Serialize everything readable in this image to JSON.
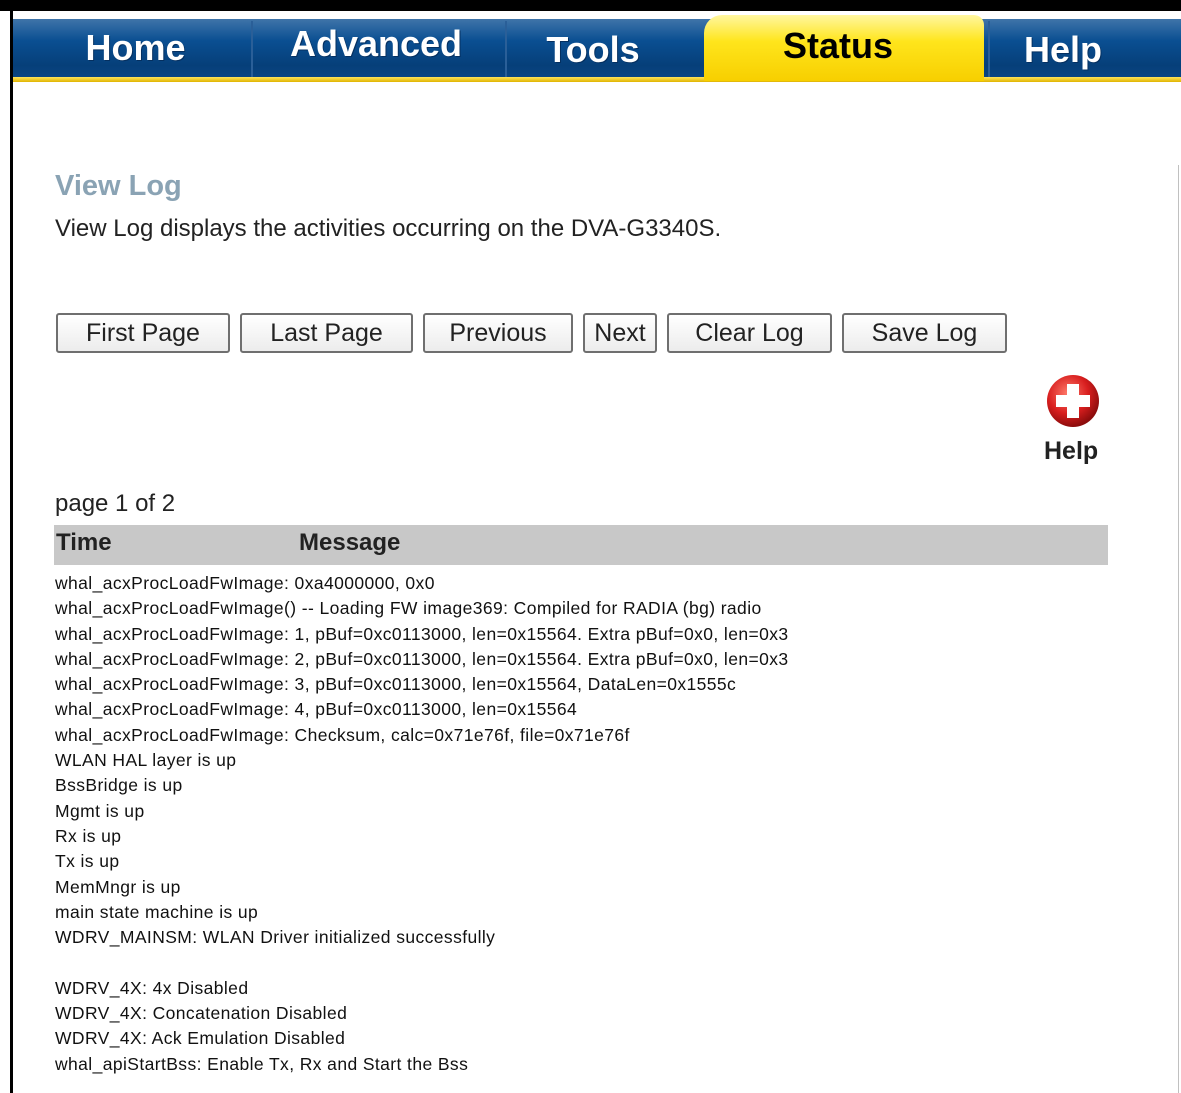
{
  "nav": {
    "tabs": [
      {
        "label": "Home",
        "active": false
      },
      {
        "label": "Advanced",
        "active": false
      },
      {
        "label": "Tools",
        "active": false
      },
      {
        "label": "Status",
        "active": true
      },
      {
        "label": "Help",
        "active": false
      }
    ]
  },
  "colors": {
    "nav_blue": "#0a4f92",
    "active_tab": "#ffe51c",
    "title": "#8aa3b4",
    "header_bg": "#c8c8c8",
    "help_icon": "#d81e1e"
  },
  "page": {
    "title": "View Log",
    "description": "View Log displays the activities occurring on the DVA-G3340S."
  },
  "buttons": {
    "first_page": "First Page",
    "last_page": "Last Page",
    "previous": "Previous",
    "next": "Next",
    "clear_log": "Clear Log",
    "save_log": "Save Log"
  },
  "help": {
    "label": "Help",
    "icon": "plus-circle-icon"
  },
  "log": {
    "page_indicator": "page 1 of 2",
    "columns": {
      "time": "Time",
      "message": "Message"
    },
    "entries": [
      "whal_acxProcLoadFwImage: 0xa4000000, 0x0",
      "whal_acxProcLoadFwImage() -- Loading FW image369: Compiled for RADIA (bg) radio",
      "whal_acxProcLoadFwImage: 1, pBuf=0xc0113000, len=0x15564. Extra pBuf=0x0, len=0x3",
      "whal_acxProcLoadFwImage: 2, pBuf=0xc0113000, len=0x15564. Extra pBuf=0x0, len=0x3",
      "whal_acxProcLoadFwImage: 3, pBuf=0xc0113000, len=0x15564, DataLen=0x1555c",
      "whal_acxProcLoadFwImage: 4, pBuf=0xc0113000, len=0x15564",
      "whal_acxProcLoadFwImage: Checksum, calc=0x71e76f, file=0x71e76f",
      "WLAN HAL layer is up",
      "BssBridge is up",
      "Mgmt is up",
      "Rx is up",
      "Tx is up",
      "MemMngr is up",
      "main state machine is up",
      "WDRV_MAINSM: WLAN Driver initialized successfully",
      "",
      "WDRV_4X: 4x Disabled",
      "WDRV_4X: Concatenation Disabled",
      "WDRV_4X: Ack Emulation Disabled",
      "whal_apiStartBss: Enable Tx, Rx and Start the Bss"
    ]
  }
}
